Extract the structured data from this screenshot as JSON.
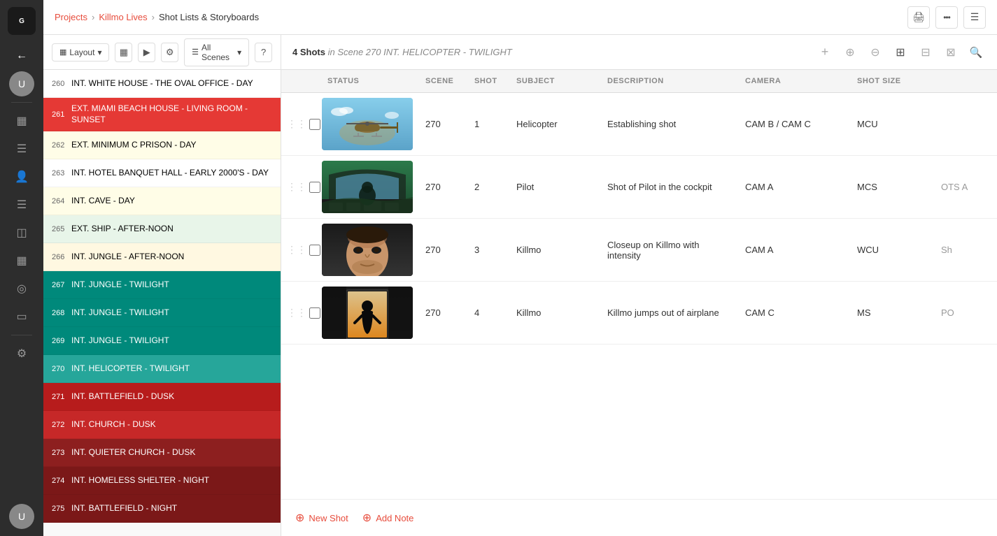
{
  "app": {
    "logo_text": "G",
    "logo_bg": "#111"
  },
  "breadcrumb": {
    "projects": "Projects",
    "project_name": "Killmo Lives",
    "current": "Shot Lists & Storyboards"
  },
  "toolbar": {
    "layout_label": "Layout",
    "all_scenes_label": "All Scenes",
    "help_label": "?"
  },
  "shot_header": {
    "count": "4 Shots",
    "scene_info": "in Scene 270 INT. HELICOPTER - TWILIGHT"
  },
  "table_headers": {
    "status": "STATUS",
    "scene": "SCENE",
    "shot": "SHOT",
    "subject": "SUBJECT",
    "description": "DESCRIPTION",
    "camera": "CAMERA",
    "shot_size": "SHOT SIZE"
  },
  "shots": [
    {
      "scene": "270",
      "shot": "1",
      "subject": "Helicopter",
      "description": "Establishing shot",
      "camera": "CAM B / CAM C",
      "shot_size": "MCU",
      "angle": "",
      "thumb_type": "heli"
    },
    {
      "scene": "270",
      "shot": "2",
      "subject": "Pilot",
      "description": "Shot of Pilot in the cockpit",
      "camera": "CAM A",
      "shot_size": "MCS",
      "angle": "OTS A",
      "thumb_type": "cockpit"
    },
    {
      "scene": "270",
      "shot": "3",
      "subject": "Killmo",
      "description": "Closeup on Killmo with intensity",
      "camera": "CAM A",
      "shot_size": "WCU",
      "angle": "Sh",
      "thumb_type": "face"
    },
    {
      "scene": "270",
      "shot": "4",
      "subject": "Killmo",
      "description": "Killmo jumps out of airplane",
      "camera": "CAM C",
      "shot_size": "MS",
      "angle": "PO",
      "thumb_type": "door"
    }
  ],
  "footer": {
    "new_shot": "New Shot",
    "add_note": "Add Note"
  },
  "scenes": [
    {
      "num": "260",
      "label": "INT. WHITE HOUSE - THE OVAL OFFICE - DAY",
      "color": "white"
    },
    {
      "num": "261",
      "label": "EXT. MIAMI BEACH HOUSE - LIVING ROOM - SUNSET",
      "color": "red-active"
    },
    {
      "num": "262",
      "label": "EXT. MINIMUM C PRISON - DAY",
      "color": "yellow-light"
    },
    {
      "num": "263",
      "label": "INT. HOTEL BANQUET HALL - EARLY 2000'S - DAY",
      "color": "white"
    },
    {
      "num": "264",
      "label": "INT. CAVE - DAY",
      "color": "yellow-light"
    },
    {
      "num": "265",
      "label": "EXT. SHIP - AFTER-NOON",
      "color": "green-light"
    },
    {
      "num": "266",
      "label": "INT. JUNGLE - AFTER-NOON",
      "color": "yellow-medium"
    },
    {
      "num": "267",
      "label": "INT. JUNGLE - TWILIGHT",
      "color": "teal"
    },
    {
      "num": "268",
      "label": "INT. JUNGLE - TWILIGHT",
      "color": "teal"
    },
    {
      "num": "269",
      "label": "INT. JUNGLE - TWILIGHT",
      "color": "teal"
    },
    {
      "num": "270",
      "label": "INT. HELICOPTER - TWILIGHT",
      "color": "teal-active"
    },
    {
      "num": "271",
      "label": "INT. BATTLEFIELD - DUSK",
      "color": "red-dusk"
    },
    {
      "num": "272",
      "label": "INT. CHURCH - DUSK",
      "color": "red-medium"
    },
    {
      "num": "273",
      "label": "INT. QUIETER CHURCH - DUSK",
      "color": "red-dark"
    },
    {
      "num": "274",
      "label": "INT. HOMELESS SHELTER - NIGHT",
      "color": "dark-red"
    },
    {
      "num": "275",
      "label": "INT. BATTLEFIELD - NIGHT",
      "color": "dark-red"
    }
  ],
  "user_avatar_initials": "U",
  "icons": {
    "arrow_left": "←",
    "chat": "💬",
    "grid": "▦",
    "list": "≡",
    "user": "👤",
    "calendar": "📅",
    "location": "📍",
    "layers": "▪",
    "sliders": "⚙",
    "print": "🖨",
    "more": "•••",
    "menu_list": "☰",
    "plus": "+",
    "zoom_in": "🔍+",
    "zoom_out": "🔍-",
    "grid_view": "⊞",
    "table_view": "⊟",
    "mosaic_view": "⊠",
    "search": "🔍",
    "drag": "⋮⋮",
    "chevron_down": "▾"
  }
}
